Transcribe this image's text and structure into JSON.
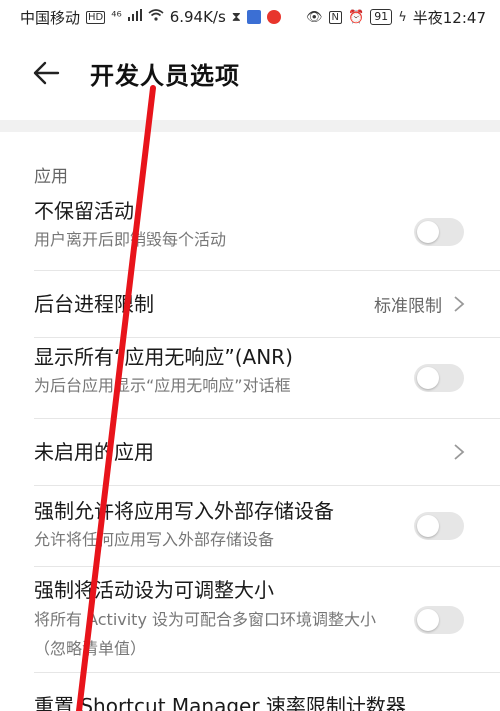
{
  "status_bar": {
    "carrier": "中国移动",
    "hd": "HD",
    "network": "⁴⁶",
    "speed": "6.94K/s",
    "battery": "91",
    "time": "半夜12:47"
  },
  "header": {
    "title": "开发人员选项"
  },
  "section": {
    "title": "应用"
  },
  "rows": [
    {
      "title": "不保留活动",
      "subtitle": "用户离开后即销毁每个活动",
      "type": "toggle",
      "checked": false
    },
    {
      "title": "后台进程限制",
      "value": "标准限制",
      "type": "link"
    },
    {
      "title": "显示所有“应用无响应”(ANR)",
      "subtitle": "为后台应用显示“应用无响应”对话框",
      "type": "toggle",
      "checked": false
    },
    {
      "title": "未启用的应用",
      "type": "link"
    },
    {
      "title": "强制允许将应用写入外部存储设备",
      "subtitle": "允许将任何应用写入外部存储设备",
      "type": "toggle",
      "checked": false
    },
    {
      "title": "强制将活动设为可调整大小",
      "subtitle": "将所有 Activity 设为可配合多窗口环境调整大小（忽略清单值）",
      "type": "toggle",
      "checked": false
    },
    {
      "title": "重置 Shortcut Manager 速率限制计数器",
      "type": "action"
    }
  ],
  "colors": {
    "annotation": "#e8141b",
    "toggle_off": "#e6e6e6",
    "divider": "#f1f1f1"
  }
}
